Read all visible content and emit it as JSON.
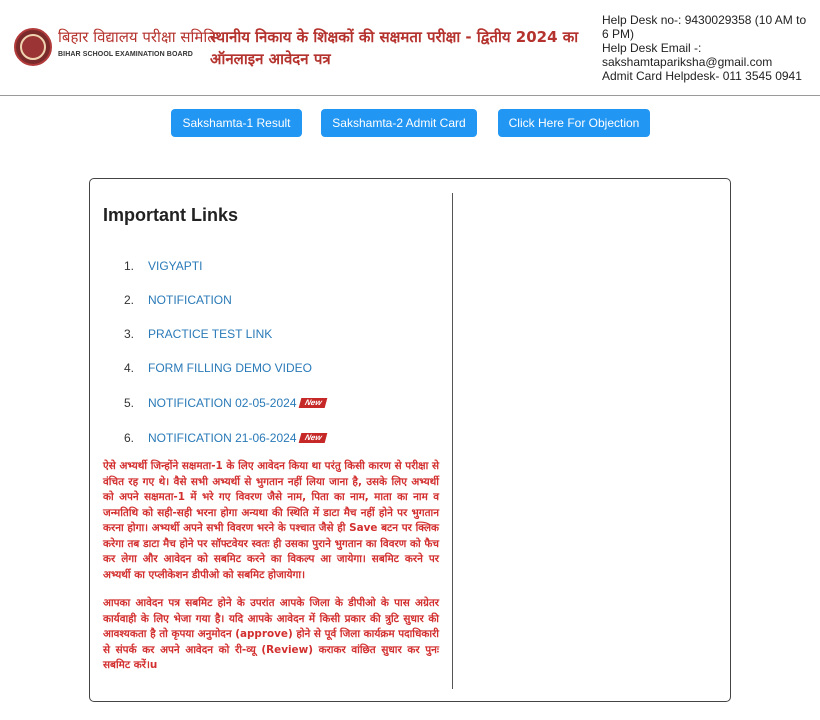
{
  "header": {
    "logo_hindi": "बिहार विद्यालय परीक्षा समिति",
    "logo_english": "BIHAR SCHOOL EXAMINATION BOARD",
    "title": "स्थानीय निकाय के शिक्षकों की सक्षमता परीक्षा - द्वितीय 2024 का ऑनलाइन आवेदन पत्र",
    "helpdesk_line1": "Help Desk no-: 9430029358 (10 AM to 6 PM)",
    "helpdesk_line2": "Help Desk Email -:",
    "helpdesk_line3": "sakshamtapariksha@gmail.com",
    "helpdesk_line4": "Admit Card Helpdesk- 011 3545 0941"
  },
  "buttons": {
    "result": "Sakshamta-1 Result",
    "admit_card": "Sakshamta-2 Admit Card",
    "objection": "Click Here For Objection"
  },
  "important_links": {
    "title": "Important Links",
    "items": [
      {
        "num": "1.",
        "label": "VIGYAPTI",
        "new": ""
      },
      {
        "num": "2.",
        "label": "NOTIFICATION",
        "new": ""
      },
      {
        "num": "3.",
        "label": "PRACTICE TEST LINK",
        "new": ""
      },
      {
        "num": "4.",
        "label": "FORM FILLING DEMO VIDEO",
        "new": ""
      },
      {
        "num": "5.",
        "label": "NOTIFICATION 02-05-2024",
        "new": "New"
      },
      {
        "num": "6.",
        "label": "NOTIFICATION 21-06-2024",
        "new": "New"
      }
    ]
  },
  "notice": {
    "para1": "ऐसे अभ्यर्थी जिन्होंने सक्षमता-1 के लिए आवेदन किया था परंतु किसी कारण से परीक्षा से वंचित रह गए थे। वैसे सभी अभ्यर्थी से भुगतान नहीं लिया जाना है, उसके लिए अभ्यर्थी को अपने सक्षमता-1 में भरे गए विवरण जैसे नाम, पिता का नाम, माता का नाम व जन्मतिथि को सही-सही भरना होगा अन्यथा की स्थिति में डाटा मैच नहीं होने पर भुगतान करना होगा। अभ्यर्थी अपने सभी विवरण भरने के पश्चात जैसे ही Save बटन पर क्लिक करेगा तब डाटा मैच होने पर सॉफ्टवेयर स्वतः ही उसका पुराने भुगतान का विवरण को फैच कर लेगा और आवेदन को सबमिट करने का विकल्प आ जायेगा। सबमिट करने पर अभ्यर्थी का एप्लीकेशन डीपीओ को सबमिट होजायेगा।",
    "para2": "आपका आवेदन पत्र सबमिट होने के उपरांत आपके जिला के डीपीओ के पास अग्रेतर कार्यवाही के लिए भेजा गया है। यदि आपके आवेदन में किसी प्रकार की त्रुटि सुधार की आवश्यकता है तो कृपया अनुमोदन (approve) होने से पूर्व जिला कार्यक्रम पदाधिकारी से संपर्क कर अपने आवेदन को री-व्यू (Review) कराकर वांछित सुधार कर पुनः सबमिट करें।u"
  },
  "colors": {
    "accent_red": "#b5332e",
    "notice_red": "#d32f2f",
    "button_blue": "#2196f3",
    "link_blue": "#2a7ab8"
  }
}
